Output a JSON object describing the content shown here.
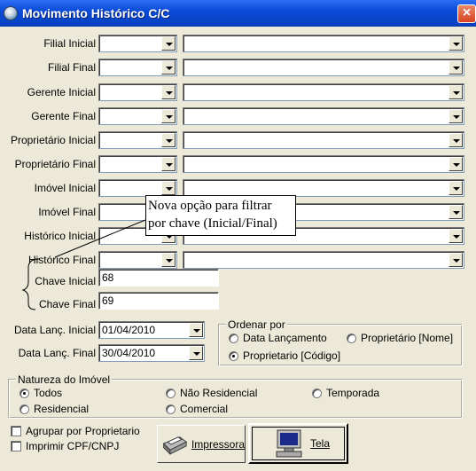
{
  "window": {
    "title": "Movimento Histórico C/C",
    "close": "×"
  },
  "filters": [
    {
      "label": "Filial Inicial"
    },
    {
      "label": "Filial Final"
    },
    {
      "label": "Gerente Inicial"
    },
    {
      "label": "Gerente Final"
    },
    {
      "label": "Proprietário Inicial"
    },
    {
      "label": "Proprietário Final"
    },
    {
      "label": "Imóvel Inicial"
    },
    {
      "label": "Imóvel Final"
    },
    {
      "label": "Histórico Inicial"
    },
    {
      "label": "Histórico Final"
    }
  ],
  "chave": {
    "inicial_label": "Chave Inicial",
    "inicial_value": "68",
    "final_label": "Chave Final",
    "final_value": "69"
  },
  "callout": {
    "line1": "Nova opção para filtrar",
    "line2": "por chave (Inicial/Final)"
  },
  "datas": {
    "inicial_label": "Data Lanç. Inicial",
    "inicial_value": "01/04/2010",
    "final_label": "Data Lanç. Final",
    "final_value": "30/04/2010"
  },
  "ordenar": {
    "title": "Ordenar por",
    "options": [
      "Data Lançamento",
      "Proprietário [Nome]",
      "Proprietario [Código]"
    ],
    "selected": "Proprietario [Código]"
  },
  "natureza": {
    "title": "Natureza do Imóvel",
    "options": [
      "Todos",
      "Não Residencial",
      "Temporada",
      "Residencial",
      "Comercial"
    ],
    "selected": "Todos"
  },
  "checks": {
    "agrupar": "Agrupar por Proprietario",
    "imprimir": "Imprimir CPF/CNPJ"
  },
  "buttons": {
    "impressora": "Impressora",
    "tela": "Tela"
  },
  "icons": {
    "app": "app-icon",
    "printer": "printer-icon",
    "monitor": "monitor-icon"
  }
}
